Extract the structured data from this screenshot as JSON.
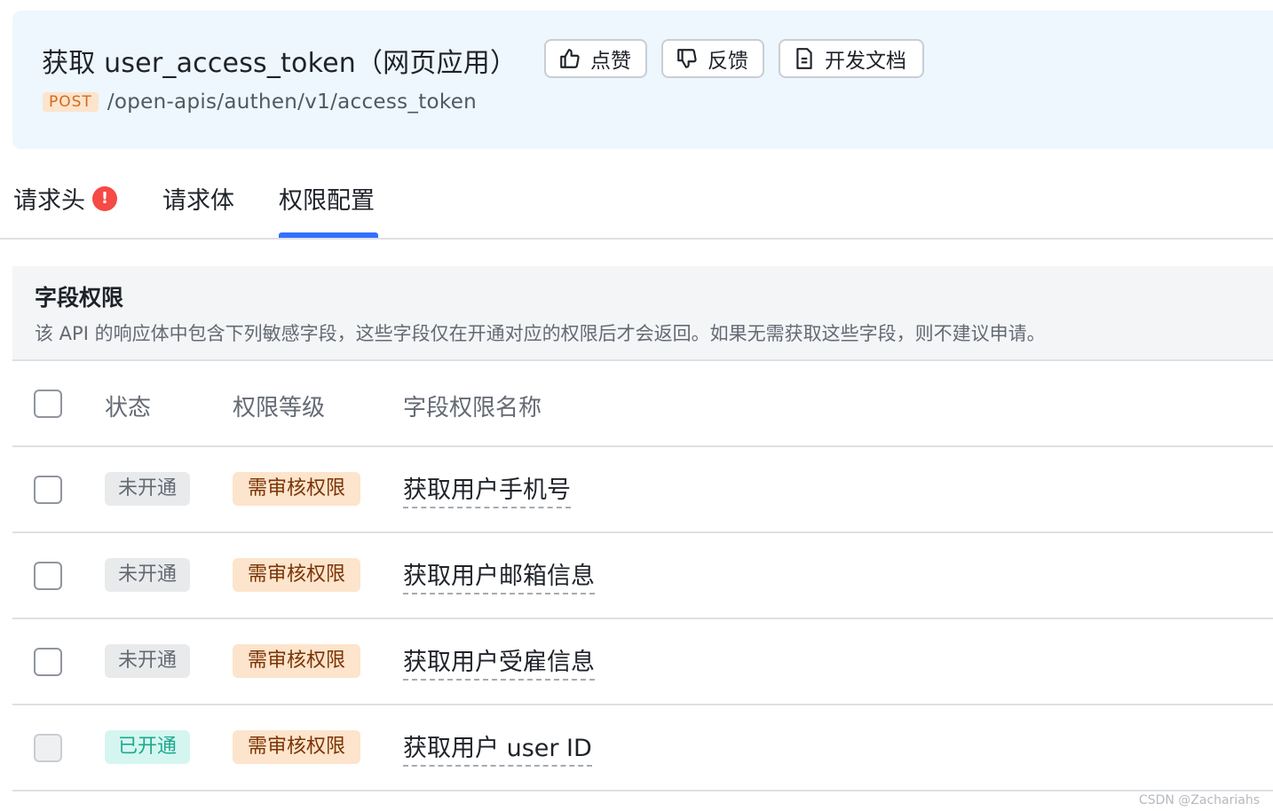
{
  "header": {
    "title": "获取 user_access_token（网页应用）",
    "method": "POST",
    "path": "/open-apis/authen/v1/access_token",
    "like_label": "点赞",
    "feedback_label": "反馈",
    "docs_label": "开发文档"
  },
  "tabs": [
    {
      "label": "请求头",
      "has_warning": true
    },
    {
      "label": "请求体"
    },
    {
      "label": "权限配置",
      "active": true
    }
  ],
  "section": {
    "title": "字段权限",
    "description": "该 API 的响应体中包含下列敏感字段，这些字段仅在开通对应的权限后才会返回。如果无需获取这些字段，则不建议申请。"
  },
  "table": {
    "headers": [
      "状态",
      "权限等级",
      "字段权限名称"
    ],
    "rows": [
      {
        "status": "未开通",
        "level": "需审核权限",
        "name": "获取用户手机号",
        "enabled": false
      },
      {
        "status": "未开通",
        "level": "需审核权限",
        "name": "获取用户邮箱信息",
        "enabled": false
      },
      {
        "status": "未开通",
        "level": "需审核权限",
        "name": "获取用户受雇信息",
        "enabled": false
      },
      {
        "status": "已开通",
        "level": "需审核权限",
        "name": "获取用户 user ID",
        "enabled": true
      }
    ]
  },
  "watermark": "CSDN @Zachariahs",
  "colors": {
    "accent": "#3370ff",
    "header_bg": "#edf7fd",
    "method_badge_bg": "#fde4cc",
    "warning": "#f54a45",
    "status_on": "#1ea88f",
    "level_tag_bg": "#fde4cc"
  }
}
